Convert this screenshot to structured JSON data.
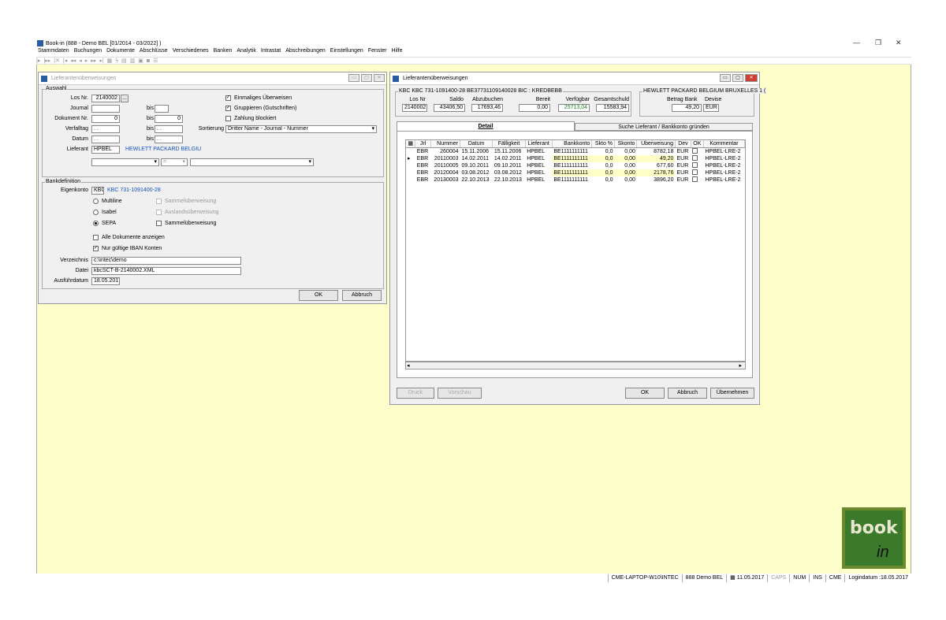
{
  "app": {
    "title": "Book-in (888 - Demo BEL [01/2014 - 03/2022] )"
  },
  "menu": [
    "Stammdaten",
    "Buchungen",
    "Dokumente",
    "Abschlüsse",
    "Verschiedenes",
    "Banken",
    "Analytik",
    "Intrastat",
    "Abschreibungen",
    "Einstellungen",
    "Fenster",
    "Hilfe"
  ],
  "toolbar": {
    "icons": [
      "first-icon",
      "last-icon",
      "delete-icon",
      "nav-first-icon",
      "nav-prev-prev-icon",
      "nav-prev-icon",
      "nav-next-icon",
      "nav-next-next-icon",
      "nav-last-icon",
      "calc-icon",
      "lightning-icon",
      "grid-icon",
      "table-icon",
      "monitor-icon",
      "window-icon",
      "list-icon"
    ]
  },
  "win1": {
    "title": "Lieferantenüberweisungen",
    "auswahl": {
      "label": "Auswahl",
      "los_label": "Los Nr.",
      "los_value": "2140002",
      "los_btn": "...",
      "journal_label": "Journal",
      "bis": "bis",
      "dok_label": "Dokument Nr.",
      "dok_from": "0",
      "dok_to": "0",
      "verfall_label": "Verfalltag",
      "verfall_from": ". .",
      "verfall_to": ". .",
      "datum_label": "Datum",
      "datum_from": ". .",
      "datum_to": ". .",
      "lief_label": "Lieferant",
      "lief_code": "HPBEL",
      "lief_name": "HEWLETT PACKARD BELGIU",
      "op": "=",
      "cb1": "Einmaliges Überweisen",
      "cb2": "Gruppieren (Gutschriften)",
      "cb3": "Zahlung blockiert",
      "sort_label": "Sortierung",
      "sort_value": "Dritter Name - Journal - Nummer"
    },
    "bank": {
      "label": "Bankdefinition",
      "eigen_label": "Eigenkonto",
      "eigen_code": "KBC",
      "eigen_value": "KBC 731-1091400-28",
      "r1": "Multiline",
      "r2": "Isabel",
      "r3": "SEPA",
      "s1": "Sammelüberweisung",
      "s2": "Auslandsüberweisung",
      "s3": "Sammelüberweisung",
      "cb_alle": "Alle Dokumente anzeigen",
      "cb_iban": "Nur gültige IBAN Konten",
      "verz_label": "Verzeichnis",
      "verz_value": "c:\\intec\\demo",
      "datei_label": "Datei",
      "datei_value": "kbcSCT-B-2140002.XML",
      "ausf_label": "Ausführdatum",
      "ausf_value": "18.05.2017"
    },
    "ok": "OK",
    "abbruch": "Abbruch"
  },
  "win2": {
    "title": "Lieferantenüberweisungen",
    "acct_caption": "KBC KBC 731-1091400-28  BE37731109140028  BIC : KREDBEBB",
    "los_h": "Los Nr",
    "saldo_h": "Saldo",
    "abzu_h": "Abzubuchen",
    "bereit_h": "Bereit",
    "verf_h": "Verfügbar",
    "ges_h": "Gesamtschuld",
    "los_v": "2140002",
    "saldo_v": "43406,50",
    "abzu_v": "17693,46",
    "bereit_v": "0,00",
    "verf_v": "25713,04",
    "ges_v": "15583,94",
    "hp_caption": "HEWLETT PACKARD BELGIUM BRUXELLES 1 (",
    "betrag_h": "Betrag Bank",
    "devise_h": "Devise",
    "betrag_v": "49,20",
    "devise_v": "EUR",
    "tab1": "Detail",
    "tab2": "Suche Lieferant / Bankkonto gründen",
    "columns": [
      "Jrl",
      "Nummer",
      "Datum",
      "Fälligkeit",
      "Lieferant",
      "Bankkonto",
      "Skto %",
      "Skonto",
      "Überweisung",
      "Dev",
      "OK",
      "Kommentar"
    ],
    "rows": [
      [
        "EBR",
        "260004",
        "15.11.2006",
        "15.11.2006",
        "HPBEL",
        "BE1111111111",
        "0,0",
        "0,00",
        "8782,18",
        "EUR",
        "",
        "HPBEL-LRE-2"
      ],
      [
        "EBR",
        "20110003",
        "14.02.2011",
        "14.02.2011",
        "HPBEL",
        "BE1111111111",
        "0,0",
        "0,00",
        "49,20",
        "EUR",
        "",
        "HPBEL-LRE-2"
      ],
      [
        "EBR",
        "20110005",
        "09.10.2011",
        "09.10.2011",
        "HPBEL",
        "BE1111111111",
        "0,0",
        "0,00",
        "677,60",
        "EUR",
        "",
        "HPBEL-LRE-2"
      ],
      [
        "EBR",
        "20120004",
        "03.08.2012",
        "03.08.2012",
        "HPBEL",
        "BE1111111111",
        "0,0",
        "0,00",
        "2178,76",
        "EUR",
        "",
        "HPBEL-LRE-2"
      ],
      [
        "EBR",
        "20130003",
        "22.10.2013",
        "22.10.2013",
        "HPBEL",
        "BE1111111111",
        "0,0",
        "0,00",
        "3896,20",
        "EUR",
        "",
        "HPBEL-LRE-2"
      ]
    ],
    "druck": "Druck",
    "vorschau": "Vorschau",
    "ok": "OK",
    "abbruch": "Abbruch",
    "uebernehmen": "Übernehmen"
  },
  "status": [
    "CME-LAPTOP-W10\\INTEC",
    "888 Demo BEL",
    "11.05.2017",
    "CAPS",
    "NUM",
    "INS",
    "CME",
    "Logindatum :18.05.2017"
  ],
  "logo": {
    "text": "book",
    "sub": "in",
    "colors": {
      "bg": "#3b7a2a",
      "frame": "#6a8a30"
    }
  }
}
